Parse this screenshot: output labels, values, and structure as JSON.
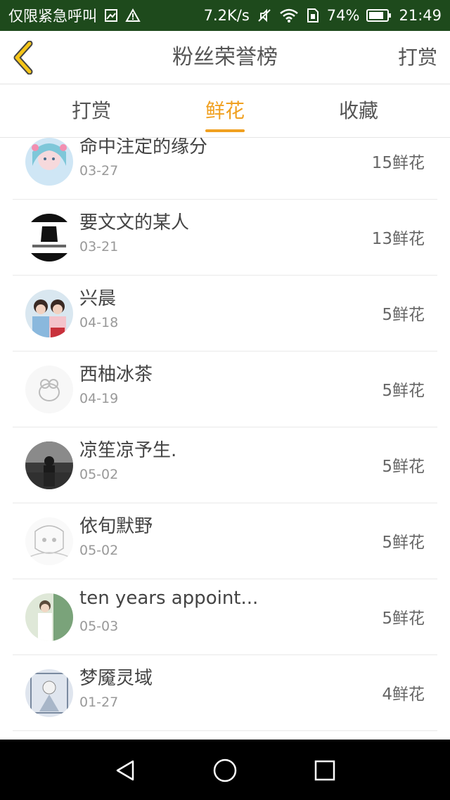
{
  "status_bar": {
    "carrier": "仅限紧急呼叫",
    "speed": "7.2K/s",
    "battery": "74%",
    "time": "21:49",
    "icons": [
      "image-icon",
      "warning-icon",
      "mute-icon",
      "wifi-icon",
      "sim-icon",
      "battery-icon"
    ]
  },
  "navbar": {
    "title": "粉丝荣誉榜",
    "action": "打赏",
    "back_icon": "chevron-left-icon",
    "accent_color": "#f0a020"
  },
  "tabs": [
    {
      "label": "打赏",
      "active": false
    },
    {
      "label": "鲜花",
      "active": true
    },
    {
      "label": "收藏",
      "active": false
    }
  ],
  "fans": [
    {
      "name": "命中注定的缘分",
      "date": "03-27",
      "count": "15鲜花"
    },
    {
      "name": "要文文的某人",
      "date": "03-21",
      "count": "13鲜花"
    },
    {
      "name": "兴晨",
      "date": "04-18",
      "count": "5鲜花"
    },
    {
      "name": "西柚冰茶",
      "date": "04-19",
      "count": "5鲜花"
    },
    {
      "name": "凉笙凉予生.",
      "date": "05-02",
      "count": "5鲜花"
    },
    {
      "name": "依旬默野",
      "date": "05-02",
      "count": "5鲜花"
    },
    {
      "name": "ten years appoint...",
      "date": "05-03",
      "count": "5鲜花"
    },
    {
      "name": "梦魇灵域",
      "date": "01-27",
      "count": "4鲜花"
    }
  ],
  "system_nav": [
    "back-triangle-icon",
    "home-circle-icon",
    "recents-square-icon"
  ]
}
